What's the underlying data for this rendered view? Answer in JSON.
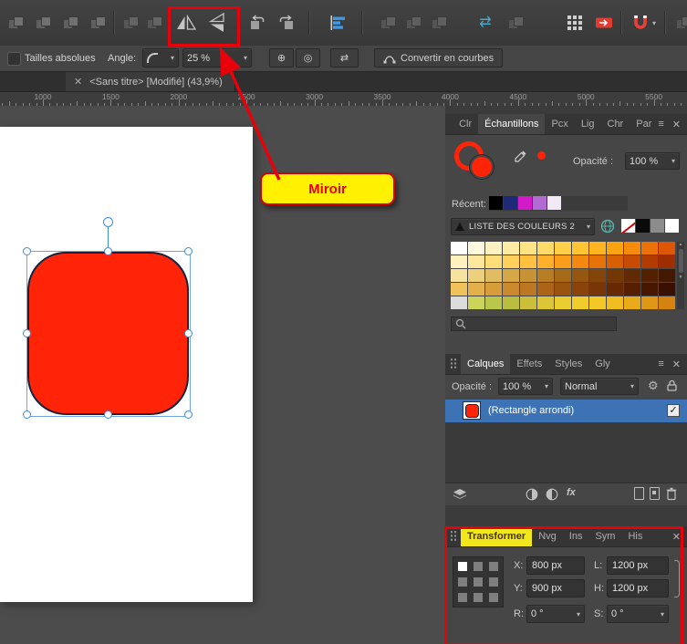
{
  "icons": {
    "caret": "▾",
    "close": "✕",
    "menu": "≡",
    "check": "✓",
    "up": "▲",
    "down": "▼",
    "target": "⊕",
    "origin": "◎",
    "cycle": "⇄",
    "gear": "⚙"
  },
  "context_toolbar": {
    "absolute_sizes": "Tailles absolues",
    "angle_label": "Angle:",
    "radius_value": "25 %",
    "convert_to_curves": "Convertir en courbes"
  },
  "document_tab": {
    "title": "<Sans titre> [Modifié] (43,9%)"
  },
  "ruler": {
    "numbers": [
      "1000",
      "1500",
      "2000",
      "2500",
      "3000",
      "3500",
      "4000",
      "4500",
      "5000",
      "5500"
    ]
  },
  "swatches_panel": {
    "tabs": [
      "Clr",
      "Échantillons",
      "Pcx",
      "Lig",
      "Chr",
      "Par"
    ],
    "opacity_label": "Opacité :",
    "opacity_value": "100 %",
    "recent_label": "Récent:",
    "recent_colors": [
      "#000000",
      "#1E2A77",
      "#D21AC8",
      "#B36BD4",
      "#F2E8F6"
    ],
    "palette_name": "LISTE DES COULEURS 2",
    "quick_swatches": [
      "none",
      "#0A0A0A",
      "#8C8C8C",
      "#FFFFFF"
    ],
    "grid_colors": [
      "#FFFFFF",
      "#FFF8E1",
      "#FFF1C2",
      "#FFEAA3",
      "#FFE385",
      "#FFDB67",
      "#FFD14B",
      "#FFC532",
      "#FFB51F",
      "#FCA311",
      "#F68B0B",
      "#EC7106",
      "#DE5503",
      "#FFF2BF",
      "#FFE89C",
      "#FFDD79",
      "#FFD05A",
      "#FFC13F",
      "#FFB02A",
      "#FB9D1A",
      "#F3880F",
      "#E77308",
      "#D75F04",
      "#C54C02",
      "#B23B02",
      "#9E2D01",
      "#F7E3A0",
      "#EDD07E",
      "#E2BC60",
      "#D5A747",
      "#C79233",
      "#B77D24",
      "#A66918",
      "#955610",
      "#84450A",
      "#733706",
      "#622A04",
      "#532102",
      "#451901",
      "#EFC25B",
      "#E4B04A",
      "#D89D3B",
      "#CB8A2E",
      "#BC7722",
      "#AC6418",
      "#9B5310",
      "#8A430A",
      "#783506",
      "#672903",
      "#561F02",
      "#471701",
      "#3A1101",
      "#DCDCDC",
      "#CBD35A",
      "#BAC74A",
      "#B9BE3E",
      "#CBBE3A",
      "#DDC635",
      "#EACB30",
      "#F1CD2B",
      "#F3C826",
      "#F0BC20",
      "#E9AB1B",
      "#DF9715",
      "#D48310"
    ]
  },
  "layers_panel": {
    "tabs": [
      "Calques",
      "Effets",
      "Styles",
      "Gly"
    ],
    "opacity_label": "Opacité :",
    "opacity_value": "100 %",
    "blend_mode": "Normal",
    "fx_label": "fx",
    "layer": {
      "name": "(Rectangle arrondi)",
      "checked": true
    }
  },
  "transform_panel": {
    "tabs": [
      "Transformer",
      "Nvg",
      "Ins",
      "Sym",
      "His"
    ],
    "x_label": "X:",
    "x_value": "800 px",
    "y_label": "Y:",
    "y_value": "900 px",
    "w_label": "L:",
    "w_value": "1200 px",
    "h_label": "H:",
    "h_value": "1200 px",
    "r_label": "R:",
    "r_value": "0 °",
    "s_label": "S:",
    "s_value": "0 °"
  },
  "annotations": {
    "mirror_label": "Miroir"
  },
  "colors": {
    "shape_fill": "#FF2408",
    "accent_red": "#E8000B",
    "highlight_yellow": "#FFF100",
    "selection_blue": "#3F8CD8"
  }
}
